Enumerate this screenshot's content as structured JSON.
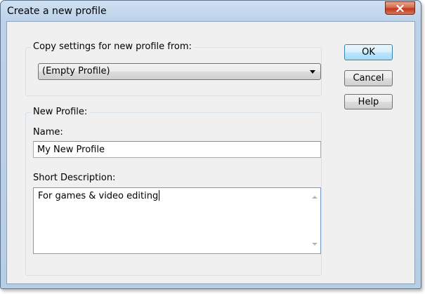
{
  "window": {
    "title": "Create a new profile",
    "close_icon": "close-x-icon"
  },
  "copy_group": {
    "label": "Copy settings for new profile from:",
    "selected": "(Empty Profile)"
  },
  "new_profile_group": {
    "label": "New Profile:",
    "name_label": "Name:",
    "name_value": "My New Profile",
    "desc_label": "Short Description:",
    "desc_value": "For games & video editing"
  },
  "buttons": {
    "ok": "OK",
    "cancel": "Cancel",
    "help": "Help"
  },
  "colors": {
    "titlebar": "#bcd2ea",
    "client": "#f0f0f0",
    "close_button": "#c2391c",
    "default_button_border": "#3c7fb1"
  }
}
